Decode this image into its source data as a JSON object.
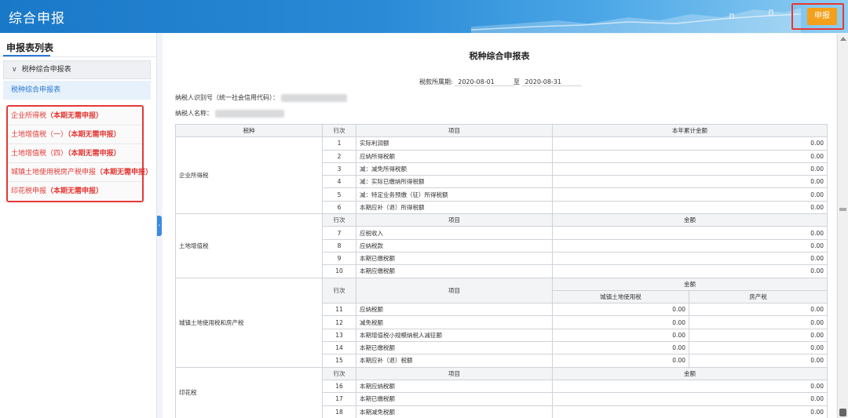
{
  "header": {
    "title": "综合申报",
    "submit_label": "申报",
    "accent": "#1a78c8",
    "button_color": "#f5a01a"
  },
  "sidebar": {
    "title": "申报表列表",
    "group_label": "税种综合申报表",
    "active_item": "税种综合申报表",
    "items": [
      {
        "name": "企业所得税",
        "note": "（本期无需申报）"
      },
      {
        "name": "土地增值税（一）",
        "note": "（本期无需申报）"
      },
      {
        "name": "土地增值税（四）",
        "note": "（本期无需申报）"
      },
      {
        "name": "城镇土地使用税房产税申报",
        "note": "（本期无需申报）"
      },
      {
        "name": "印花税申报",
        "note": "（本期无需申报）"
      }
    ]
  },
  "form": {
    "title": "税种综合申报表",
    "period_label": "税款所属期:",
    "period_start": "2020-08-01",
    "period_to": "至",
    "period_end": "2020-08-31",
    "taxpayer_id_label": "纳税人识别号（统一社会信用代码）：",
    "taxpayer_name_label": "纳税人名称："
  },
  "table": {
    "header": {
      "col_tax": "税种",
      "col_row": "行次",
      "col_item": "项目",
      "col_amount": "本年累计金额"
    },
    "sub_row": "行次",
    "sub_item": "项目",
    "amount": "金额",
    "land_use_tax": "城镇土地使用税",
    "property_tax": "房产税",
    "cit": {
      "name": "企业所得税",
      "rows": [
        {
          "no": "1",
          "item": "实际利润额",
          "v": "0.00"
        },
        {
          "no": "2",
          "item": "应纳所得税额",
          "v": "0.00"
        },
        {
          "no": "3",
          "item": "减：减免所得税额",
          "v": "0.00"
        },
        {
          "no": "4",
          "item": "减：实际已缴纳所得税额",
          "v": "0.00"
        },
        {
          "no": "5",
          "item": "减：特定业务预缴（征）所得税额",
          "v": "0.00"
        },
        {
          "no": "6",
          "item": "本期应补（退）所得税额",
          "v": "0.00"
        }
      ]
    },
    "lvat": {
      "name": "土地增值税",
      "rows": [
        {
          "no": "7",
          "item": "应税收入",
          "v": "0.00"
        },
        {
          "no": "8",
          "item": "应纳税款",
          "v": "0.00"
        },
        {
          "no": "9",
          "item": "本期已缴税额",
          "v": "0.00"
        },
        {
          "no": "10",
          "item": "本期应缴税额",
          "v": "0.00"
        }
      ]
    },
    "land": {
      "name": "城镇土地使用税和房产税",
      "rows": [
        {
          "no": "11",
          "item": "应纳税额",
          "a": "0.00",
          "b": "0.00"
        },
        {
          "no": "12",
          "item": "减免税额",
          "a": "0.00",
          "b": "0.00"
        },
        {
          "no": "13",
          "item": "本期增值税小规模纳税人减征额",
          "a": "0.00",
          "b": "0.00"
        },
        {
          "no": "14",
          "item": "本期已缴税额",
          "a": "0.00",
          "b": "0.00"
        },
        {
          "no": "15",
          "item": "本期应补（退）税额",
          "a": "0.00",
          "b": "0.00"
        }
      ]
    },
    "stamp": {
      "name": "印花税",
      "rows": [
        {
          "no": "16",
          "item": "本期应纳税额",
          "v": "0.00"
        },
        {
          "no": "17",
          "item": "本期已缴税额",
          "v": "0.00"
        },
        {
          "no": "18",
          "item": "本期减免税额",
          "v": "0.00"
        }
      ]
    }
  }
}
